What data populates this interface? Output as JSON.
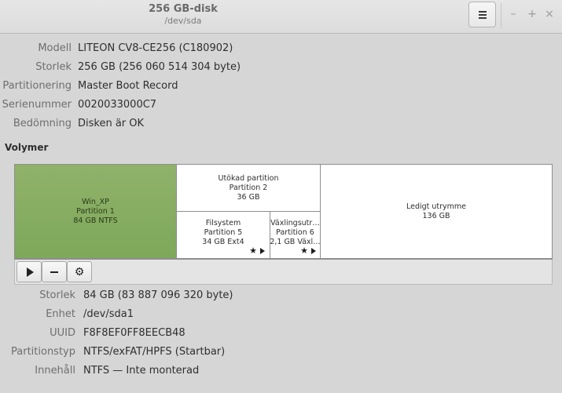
{
  "window": {
    "title": "256 GB-disk",
    "subtitle": "/dev/sda",
    "minimize": "–",
    "maximize": "+",
    "close": "×"
  },
  "drive": {
    "rows": [
      {
        "label": "Modell",
        "value": "LITEON CV8-CE256 (C180902)"
      },
      {
        "label": "Storlek",
        "value": "256 GB (256 060 514 304 byte)"
      },
      {
        "label": "Partitionering",
        "value": "Master Boot Record"
      },
      {
        "label": "Serienummer",
        "value": "0020033000C7"
      },
      {
        "label": "Bedömning",
        "value": "Disken är OK"
      }
    ]
  },
  "volumes": {
    "title": "Volymer",
    "items": [
      {
        "lines": [
          "Win_XP",
          "Partition 1",
          "84 GB NTFS"
        ],
        "selected": true
      },
      {
        "lines": [
          "Utökad partition",
          "Partition 2",
          "36 GB"
        ],
        "selected": false
      },
      {
        "lines": [
          "Filsystem",
          "Partition 5",
          "34 GB Ext4"
        ],
        "selected": false
      },
      {
        "lines": [
          "Växlingsutr…",
          "Partition 6",
          "2,1 GB Växl…"
        ],
        "selected": false
      },
      {
        "lines": [
          "Ledigt utrymme",
          "136 GB"
        ],
        "selected": false
      }
    ],
    "toolbar_icons": [
      "play-icon",
      "minus-icon",
      "gear-icon"
    ],
    "accent_selected": "#8fb26a"
  },
  "volume_details": {
    "rows": [
      {
        "label": "Storlek",
        "value": "84 GB (83 887 096 320 byte)"
      },
      {
        "label": "Enhet",
        "value": "/dev/sda1"
      },
      {
        "label": "UUID",
        "value": "F8F8EF0FF8EECB48"
      },
      {
        "label": "Partitionstyp",
        "value": "NTFS/exFAT/HPFS (Startbar)"
      },
      {
        "label": "Innehåll",
        "value": "NTFS — Inte monterad"
      }
    ]
  }
}
